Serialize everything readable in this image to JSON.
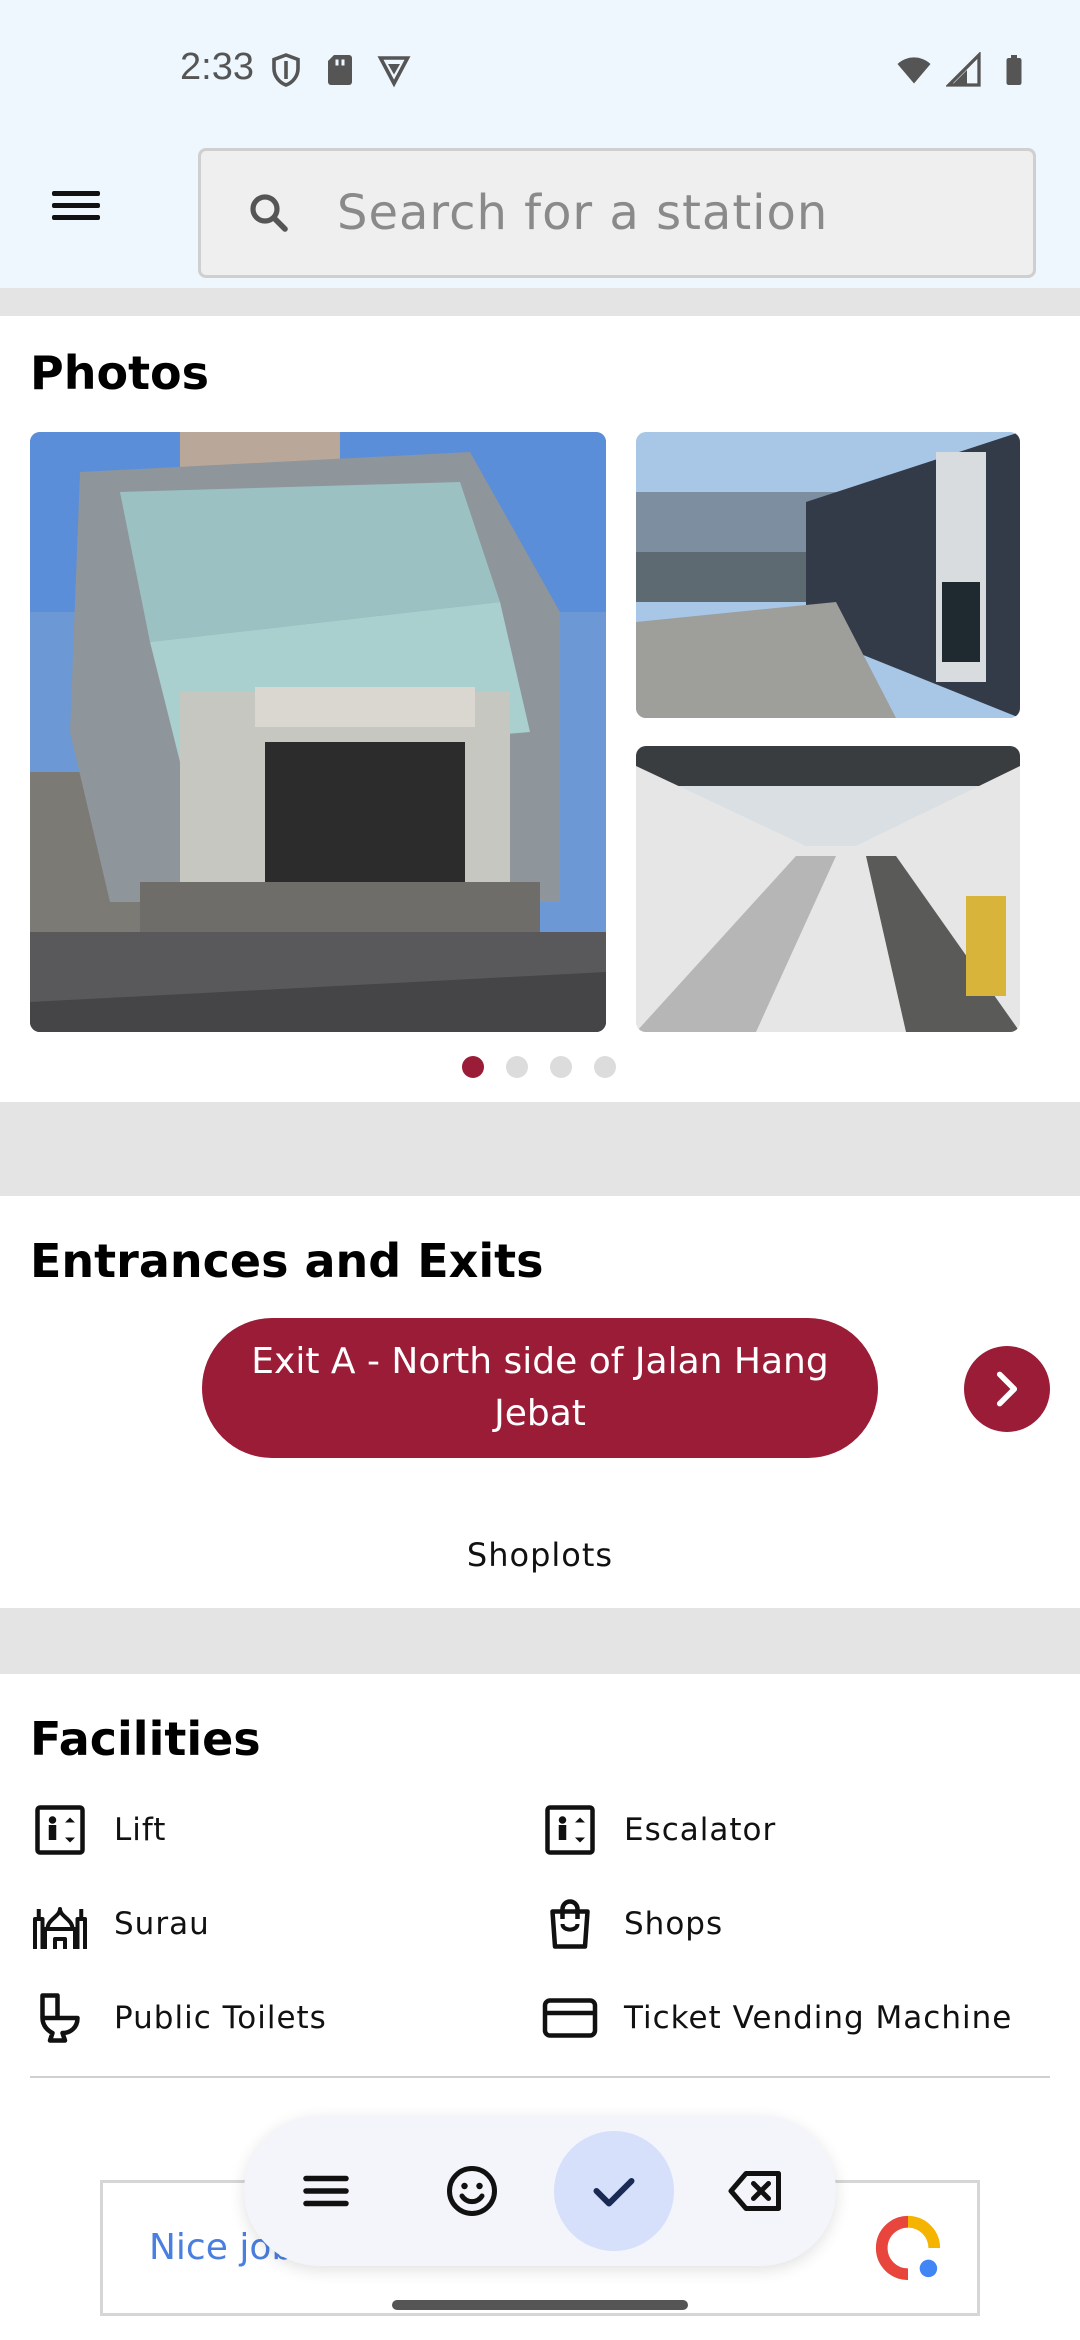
{
  "status_bar": {
    "time": "2:33",
    "left_icons": [
      "shield-icon",
      "sd-card-icon",
      "vpn-icon"
    ],
    "right_icons": [
      "wifi-icon",
      "signal-icon",
      "battery-icon"
    ]
  },
  "header": {
    "menu_icon": "hamburger-menu-icon",
    "search": {
      "placeholder": "Search for a station",
      "value": ""
    }
  },
  "photos": {
    "title": "Photos",
    "images": [
      "Merdeka station entrance",
      "Pintu Entrance A",
      "Underground walkway with travelator"
    ],
    "page_count": 4,
    "active_page": 1
  },
  "entrances": {
    "title": "Entrances and Exits",
    "current_exit": "Exit A - North side of Jalan Hang Jebat",
    "description": "Shoplots",
    "next_icon": "chevron-right-icon"
  },
  "facilities": {
    "title": "Facilities",
    "items": [
      {
        "label": "Lift",
        "icon": "lift-icon"
      },
      {
        "label": "Escalator",
        "icon": "escalator-icon"
      },
      {
        "label": "Surau",
        "icon": "mosque-icon"
      },
      {
        "label": "Shops",
        "icon": "shopping-bag-icon"
      },
      {
        "label": "Public Toilets",
        "icon": "toilet-icon"
      },
      {
        "label": "Ticket Vending Machine",
        "icon": "credit-card-icon"
      }
    ]
  },
  "ad": {
    "text": "Nice job"
  },
  "keyboard_toolbar": {
    "buttons": [
      "menu-icon",
      "emoji-icon",
      "check-icon",
      "backspace-icon"
    ],
    "selected": "check-icon"
  },
  "colors": {
    "accent": "#9a1c37",
    "header_bg": "#eef7fd",
    "section_gap": "#e4e4e4"
  }
}
